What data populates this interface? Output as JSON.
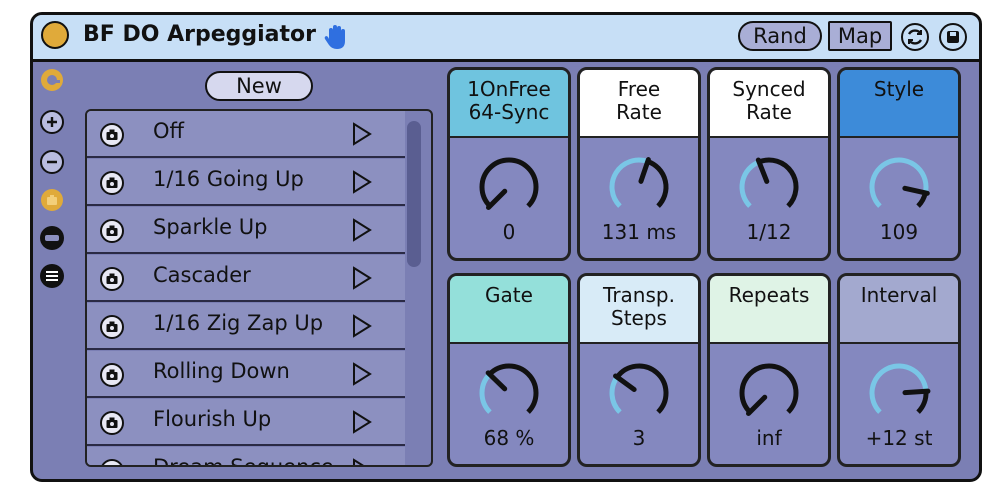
{
  "app": {
    "title": "BF DO Arpeggiator",
    "rand_label": "Rand",
    "map_label": "Map"
  },
  "colors": {
    "frame_bg": "#7b7fb4",
    "titlebar_bg": "#c7dff6",
    "accent_orange": "#e0aa3a",
    "knob_arc": "#7ac6e6"
  },
  "presets": {
    "new_label": "New",
    "items": [
      {
        "label": "Off"
      },
      {
        "label": "1/16 Going Up"
      },
      {
        "label": "Sparkle Up"
      },
      {
        "label": "Cascader"
      },
      {
        "label": "1/16 Zig Zap Up"
      },
      {
        "label": "Rolling Down"
      },
      {
        "label": "Flourish Up"
      },
      {
        "label": "Dream Sequence"
      }
    ]
  },
  "knobs": [
    {
      "label": "1OnFree\n64-Sync",
      "value": "0",
      "header_color": "#6fc4df",
      "level": 0.0
    },
    {
      "label": "Free\nRate",
      "value": "131 ms",
      "header_color": "#ffffff",
      "level": 0.57
    },
    {
      "label": "Synced\nRate",
      "value": "1/12",
      "header_color": "#ffffff",
      "level": 0.42
    },
    {
      "label": "Style",
      "value": "109",
      "header_color": "#3d8bd9",
      "level": 0.88
    },
    {
      "label": "Gate",
      "value": "68 %",
      "header_color": "#94e0da",
      "level": 0.33
    },
    {
      "label": "Transp.\nSteps",
      "value": "3",
      "header_color": "#d8ebf7",
      "level": 0.3
    },
    {
      "label": "Repeats",
      "value": "inf",
      "header_color": "#dff3e6",
      "level": 0.0
    },
    {
      "label": "Interval",
      "value": "+12 st",
      "header_color": "#a3a9cf",
      "level": 0.82
    }
  ]
}
